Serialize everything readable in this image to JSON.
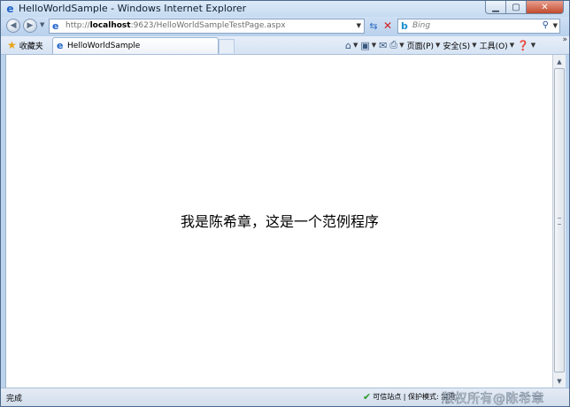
{
  "window": {
    "title": "HelloWorldSample - Windows Internet Explorer"
  },
  "address": {
    "url_prefix": "http://",
    "url_host": "localhost",
    "url_rest": ":9623/HelloWorldSampleTestPage.aspx"
  },
  "search": {
    "placeholder": "Bing"
  },
  "command_bar": {
    "favorites_label": "收藏夹",
    "tab_label": "HelloWorldSample",
    "page_menu": "页面(P)",
    "safety_menu": "安全(S)",
    "tools_menu": "工具(O)"
  },
  "page": {
    "message": "我是陈希章，这是一个范例程序"
  },
  "status": {
    "left_text": "完成",
    "zone_text": "可信站点 | 保护模式: 禁用"
  },
  "watermark": "版权所有@陈希章",
  "icons": {
    "ie": "ie-logo-icon",
    "favorites": "star-icon",
    "home": "home-icon",
    "feeds": "rss-icon",
    "mail": "mail-icon",
    "print": "printer-icon",
    "help": "help-icon",
    "check": "check-icon"
  },
  "colors": {
    "close_button": "#c24a2d",
    "ie_blue": "#1f63c8"
  }
}
